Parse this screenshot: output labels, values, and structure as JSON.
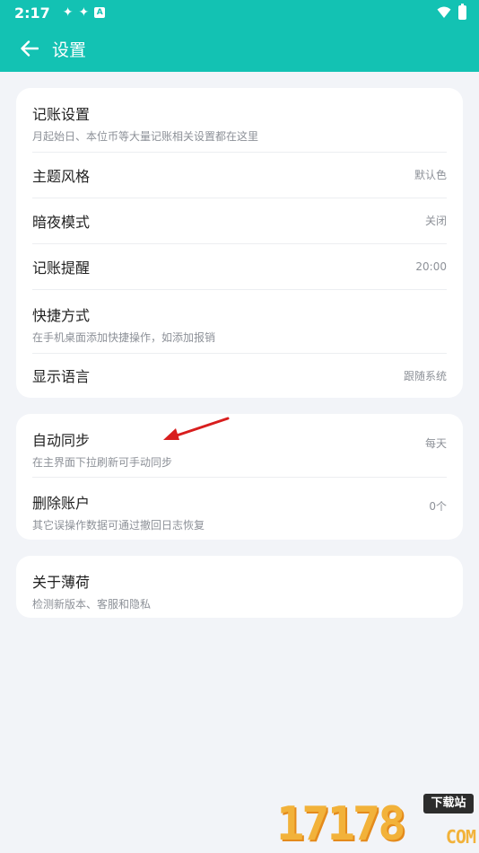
{
  "status_bar": {
    "time": "2:17",
    "notification_badge": "A"
  },
  "header": {
    "title": "设置"
  },
  "card1": {
    "items": [
      {
        "title": "记账设置",
        "subtitle": "月起始日、本位币等大量记账相关设置都在这里"
      },
      {
        "title": "主题风格",
        "value": "默认色"
      },
      {
        "title": "暗夜模式",
        "value": "关闭"
      },
      {
        "title": "记账提醒",
        "value": "20:00"
      },
      {
        "title": "快捷方式",
        "subtitle": "在手机桌面添加快捷操作，如添加报销"
      },
      {
        "title": "显示语言",
        "value": "跟随系统"
      }
    ]
  },
  "card2": {
    "items": [
      {
        "title": "自动同步",
        "subtitle": "在主界面下拉刷新可手动同步",
        "value": "每天"
      },
      {
        "title": "删除账户",
        "subtitle": "其它误操作数据可通过撤回日志恢复",
        "value": "0个"
      }
    ]
  },
  "card3": {
    "items": [
      {
        "title": "关于薄荷",
        "subtitle": "检测新版本、客服和隐私"
      }
    ]
  },
  "watermark": {
    "number": "17178",
    "badge": "下载站",
    "suffix": "COM"
  },
  "colors": {
    "primary": "#13c2b3",
    "background": "#f2f4f8",
    "annotation_arrow": "#d81e1e"
  }
}
